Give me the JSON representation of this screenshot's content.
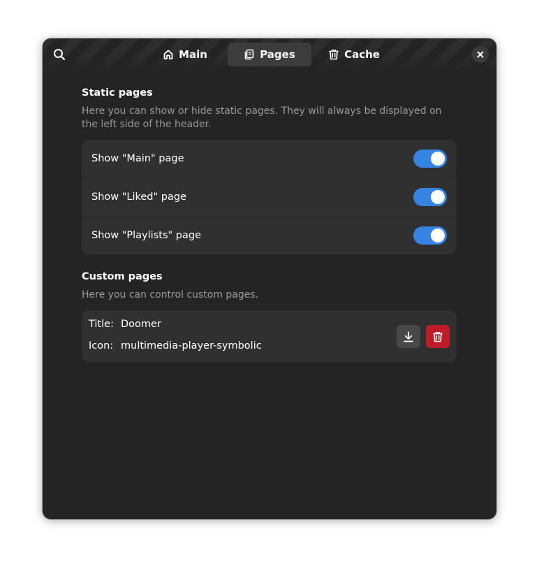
{
  "header": {
    "tabs": [
      {
        "label": "Main",
        "icon": "home-icon",
        "active": false
      },
      {
        "label": "Pages",
        "icon": "pages-icon",
        "active": true
      },
      {
        "label": "Cache",
        "icon": "trash-icon",
        "active": false
      }
    ],
    "search_icon": "search-icon",
    "close_icon": "close-icon"
  },
  "static_pages": {
    "title": "Static pages",
    "description": "Here you can show or hide static pages. They will always be displayed on the left side of the header.",
    "rows": [
      {
        "label": "Show \"Main\" page",
        "enabled": true
      },
      {
        "label": "Show \"Liked\" page",
        "enabled": true
      },
      {
        "label": "Show \"Playlists\" page",
        "enabled": true
      }
    ]
  },
  "custom_pages": {
    "title": "Custom pages",
    "description": "Here you can control custom pages.",
    "items": [
      {
        "title_key": "Title:",
        "title_value": "Doomer",
        "icon_key": "Icon:",
        "icon_value": "multimedia-player-symbolic",
        "download_icon": "download-icon",
        "delete_icon": "trash-icon"
      }
    ]
  },
  "colors": {
    "window_bg": "#242424",
    "card_bg": "#303030",
    "accent": "#3584e4",
    "destructive": "#c01c28"
  }
}
